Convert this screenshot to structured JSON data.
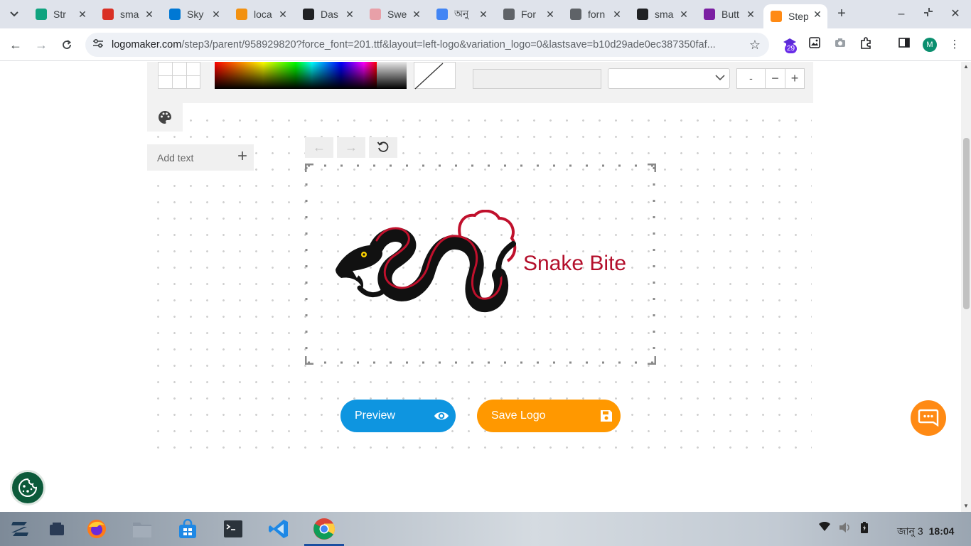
{
  "browser": {
    "tabs": [
      {
        "title": "Str",
        "icon": "chatgpt-icon",
        "color": "#10a37f"
      },
      {
        "title": "sma",
        "icon": "gmail-icon",
        "color": "#d93025"
      },
      {
        "title": "Sky",
        "icon": "skype-icon",
        "color": "#0078d4"
      },
      {
        "title": "loca",
        "icon": "phpmyadmin-icon",
        "color": "#f29111"
      },
      {
        "title": "Das",
        "icon": "dashboard-icon",
        "color": "#202124"
      },
      {
        "title": "Swe",
        "icon": "sweetalert-icon",
        "color": "#e8a0a8"
      },
      {
        "title": "অনু",
        "icon": "google-icon",
        "color": "#4285f4"
      },
      {
        "title": "For",
        "icon": "globe-icon",
        "color": "#5f6368"
      },
      {
        "title": "forn",
        "icon": "globe-icon",
        "color": "#5f6368"
      },
      {
        "title": "sma",
        "icon": "github-icon",
        "color": "#202124"
      },
      {
        "title": "Butt",
        "icon": "bootstrap-icon",
        "color": "#7b1fa2"
      },
      {
        "title": "Step",
        "icon": "logomaker-icon",
        "color": "#ff8a14"
      }
    ],
    "url_host": "logomaker.com",
    "url_path": "/step3/parent/958929820?force_font=201.ttf&layout=left-logo&variation_logo=0&lastsave=b10d29ade0ec387350faf...",
    "extension_badge": "29",
    "profile_initial": "M"
  },
  "editor": {
    "stepper_value": "-",
    "add_text_label": "Add text",
    "brand_name": "Snake Bite",
    "brand_color": "#b30e2a"
  },
  "actions": {
    "preview_label": "Preview",
    "save_label": "Save Logo",
    "preview_color": "#0e95e0",
    "save_color": "#ff9800"
  },
  "taskbar": {
    "date": "জানু 3",
    "time": "18:04"
  }
}
